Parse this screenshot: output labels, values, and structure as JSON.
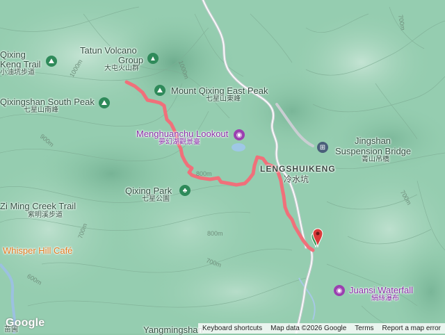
{
  "labels": {
    "tatun_en": "Tatun Volcano",
    "tatun_en2": "Group",
    "tatun_zh": "大屯火山群",
    "qixing_keng_en": "Qixing",
    "qixing_keng_en2": "Keng Trail",
    "qixing_keng_zh": "小油坑步道",
    "qixingshan_south_en": "Qixingshan South Peak",
    "qixingshan_south_zh": "七星山南峰",
    "east_peak_en": "Mount Qixing East Peak",
    "east_peak_zh": "七星山東峰",
    "menghuanchu_en": "Menghuanchu Lookout",
    "menghuanchu_zh": "夢幻湖觀景臺",
    "jingshan_en1": "Jingshan",
    "jingshan_en2": "Suspension Bridge",
    "jingshan_zh": "菁山吊橋",
    "lengshuikeng_en": "LENGSHUIKENG",
    "lengshuikeng_zh": "冷水坑",
    "qixing_park_en": "Qixing Park",
    "qixing_park_zh": "七星公園",
    "ziming_en": "Zi Ming Creek Trail",
    "ziming_zh": "紫明溪步道",
    "whisper_en": "Whisper Hill Café",
    "juansi_en": "Juansi Waterfall",
    "juansi_zh": "絹絲瀑布",
    "yangmingshan": "Yangmingshan",
    "bottom_zh": "苗圃"
  },
  "contours": {
    "c1000": "1000m",
    "c1000b": "1000m",
    "c900": "900m",
    "c800a": "800m",
    "c800b": "800m",
    "c700a": "700m",
    "c700b": "700m",
    "c700c": "700m",
    "c600": "600m",
    "c700d": "700m"
  },
  "footer": {
    "shortcuts": "Keyboard shortcuts",
    "map_data": "Map data ©2026 Google",
    "terms": "Terms",
    "report": "Report a map error"
  },
  "brand": "Google",
  "colors": {
    "route": "#f0707a",
    "marker": "#d93a3a",
    "start_marker": "#3a9a5a",
    "poi_purple": "#9b3fb0",
    "poi_green": "#2f8a5a",
    "poi_slate": "#4a5f7a"
  },
  "icons": {
    "peak": "mountain-icon",
    "trail": "hiker-icon",
    "lookout": "camera-icon",
    "park": "tree-icon",
    "bridge": "bridge-icon",
    "waterfall": "camera-icon",
    "end": "map-pin-icon"
  }
}
